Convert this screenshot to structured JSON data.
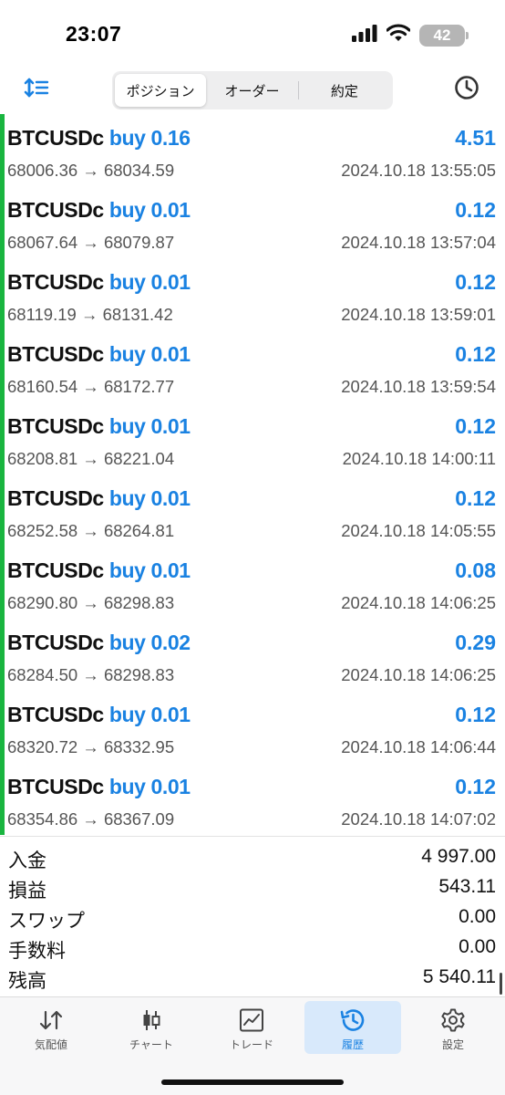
{
  "status": {
    "time": "23:07",
    "battery": "42"
  },
  "toolbar": {
    "segments": [
      {
        "label": "ポジション"
      },
      {
        "label": "オーダー"
      },
      {
        "label": "約定"
      }
    ],
    "active_segment": "ポジション"
  },
  "colors": {
    "accent": "#1a82e2",
    "profit_bar": "#19b53f",
    "active_tab_bg": "#d8e9fb"
  },
  "deals": [
    {
      "symbol": "BTCUSDc",
      "side": "buy 0.16",
      "profit": "4.51",
      "prices": "68006.36 → 68034.59",
      "time": "2024.10.18 13:55:05"
    },
    {
      "symbol": "BTCUSDc",
      "side": "buy 0.01",
      "profit": "0.12",
      "prices": "68067.64 → 68079.87",
      "time": "2024.10.18 13:57:04"
    },
    {
      "symbol": "BTCUSDc",
      "side": "buy 0.01",
      "profit": "0.12",
      "prices": "68119.19 → 68131.42",
      "time": "2024.10.18 13:59:01"
    },
    {
      "symbol": "BTCUSDc",
      "side": "buy 0.01",
      "profit": "0.12",
      "prices": "68160.54 → 68172.77",
      "time": "2024.10.18 13:59:54"
    },
    {
      "symbol": "BTCUSDc",
      "side": "buy 0.01",
      "profit": "0.12",
      "prices": "68208.81 → 68221.04",
      "time": "2024.10.18 14:00:11"
    },
    {
      "symbol": "BTCUSDc",
      "side": "buy 0.01",
      "profit": "0.12",
      "prices": "68252.58 → 68264.81",
      "time": "2024.10.18 14:05:55"
    },
    {
      "symbol": "BTCUSDc",
      "side": "buy 0.01",
      "profit": "0.08",
      "prices": "68290.80 → 68298.83",
      "time": "2024.10.18 14:06:25"
    },
    {
      "symbol": "BTCUSDc",
      "side": "buy 0.02",
      "profit": "0.29",
      "prices": "68284.50 → 68298.83",
      "time": "2024.10.18 14:06:25"
    },
    {
      "symbol": "BTCUSDc",
      "side": "buy 0.01",
      "profit": "0.12",
      "prices": "68320.72 → 68332.95",
      "time": "2024.10.18 14:06:44"
    },
    {
      "symbol": "BTCUSDc",
      "side": "buy 0.01",
      "profit": "0.12",
      "prices": "68354.86 → 68367.09",
      "time": "2024.10.18 14:07:02"
    }
  ],
  "summary": [
    {
      "label": "入金",
      "value": "4 997.00"
    },
    {
      "label": "損益",
      "value": "543.11"
    },
    {
      "label": "スワップ",
      "value": "0.00"
    },
    {
      "label": "手数料",
      "value": "0.00"
    },
    {
      "label": "残高",
      "value": "5 540.11"
    }
  ],
  "tabs": [
    {
      "label": "気配値",
      "icon": "quotes-arrows-icon"
    },
    {
      "label": "チャート",
      "icon": "candlestick-chart-icon"
    },
    {
      "label": "トレード",
      "icon": "trade-line-chart-icon"
    },
    {
      "label": "履歴",
      "icon": "history-clock-icon"
    },
    {
      "label": "設定",
      "icon": "settings-gear-icon"
    }
  ],
  "active_tab": "履歴"
}
